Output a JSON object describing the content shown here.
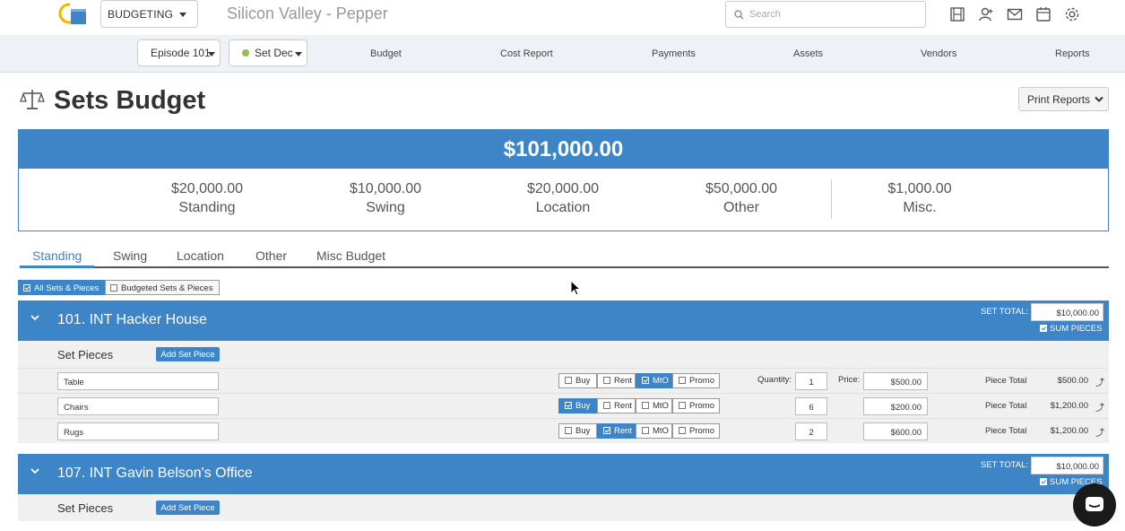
{
  "topbar": {
    "module": "BUDGETING",
    "project_title": "Silicon Valley - Pepper",
    "search_placeholder": "Search",
    "icons": [
      "film-icon",
      "user-plus-icon",
      "mail-icon",
      "calendar-icon",
      "gear-icon"
    ]
  },
  "navbar": {
    "episode": "Episode 101",
    "department": "Set Dec",
    "department_color": "#8bc34a",
    "links": [
      "Budget",
      "Cost Report",
      "Payments",
      "Assets",
      "Vendors",
      "Reports"
    ]
  },
  "page": {
    "title": "Sets Budget",
    "print_reports": "Print Reports"
  },
  "summary": {
    "total": "$101,000.00",
    "stats": [
      {
        "amount": "$20,000.00",
        "label": "Standing"
      },
      {
        "amount": "$10,000.00",
        "label": "Swing"
      },
      {
        "amount": "$20,000.00",
        "label": "Location"
      },
      {
        "amount": "$50,000.00",
        "label": "Other"
      },
      {
        "amount": "$1,000.00",
        "label": "Misc."
      }
    ]
  },
  "tabs": [
    "Standing",
    "Swing",
    "Location",
    "Other",
    "Misc Budget"
  ],
  "filters": {
    "all": "All Sets & Pieces",
    "budgeted": "Budgeted Sets & Pieces"
  },
  "labels": {
    "set_total": "SET TOTAL:",
    "sum_pieces": "SUM PIECES",
    "set_pieces": "Set Pieces",
    "add_set_piece": "Add Set Piece",
    "quantity": "Quantity:",
    "price": "Price:",
    "piece_total": "Piece Total",
    "buy": "Buy",
    "rent": "Rent",
    "mto": "MtO",
    "promo": "Promo"
  },
  "sets": [
    {
      "title": "101. INT Hacker House",
      "set_total": "$10,000.00",
      "pieces": [
        {
          "name": "Table",
          "selected": "MtO",
          "quantity": "1",
          "price": "$500.00",
          "total": "$500.00"
        },
        {
          "name": "Chairs",
          "selected": "Buy",
          "quantity": "6",
          "price": "$200.00",
          "total": "$1,200.00"
        },
        {
          "name": "Rugs",
          "selected": "Rent",
          "quantity": "2",
          "price": "$600.00",
          "total": "$1,200.00"
        }
      ]
    },
    {
      "title": "107. INT Gavin Belson's Office",
      "set_total": "$10,000.00",
      "pieces": []
    }
  ]
}
